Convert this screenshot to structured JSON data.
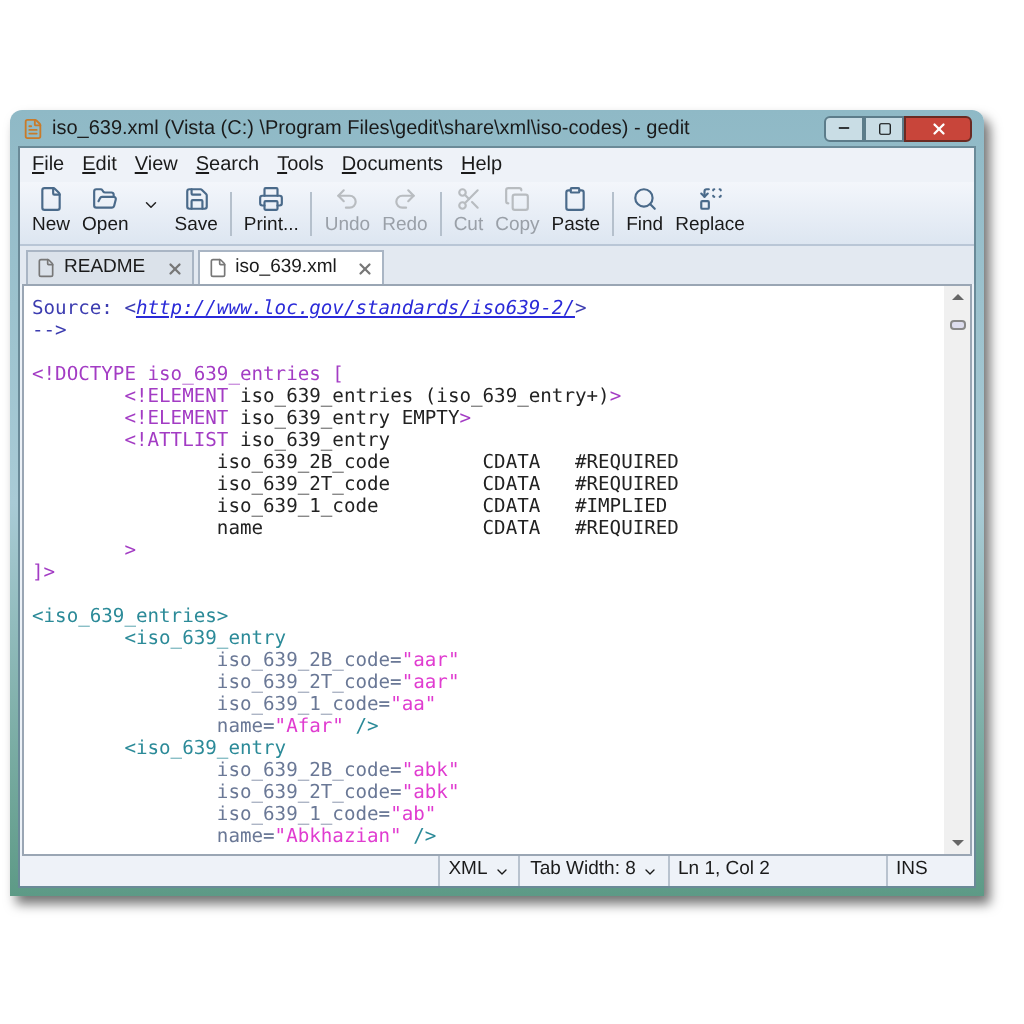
{
  "window": {
    "title": "iso_639.xml (Vista (C:) \\Program Files\\gedit\\share\\xml\\iso-codes) - gedit"
  },
  "menu": [
    "File",
    "Edit",
    "View",
    "Search",
    "Tools",
    "Documents",
    "Help"
  ],
  "toolbar": [
    {
      "label": "New",
      "disabled": false
    },
    {
      "label": "Open",
      "disabled": false
    },
    {
      "label": "Save",
      "disabled": false
    },
    {
      "label": "Print...",
      "disabled": false
    },
    {
      "label": "Undo",
      "disabled": true
    },
    {
      "label": "Redo",
      "disabled": true
    },
    {
      "label": "Cut",
      "disabled": true
    },
    {
      "label": "Copy",
      "disabled": true
    },
    {
      "label": "Paste",
      "disabled": false
    },
    {
      "label": "Find",
      "disabled": false
    },
    {
      "label": "Replace",
      "disabled": false
    }
  ],
  "tabs": [
    {
      "label": "README",
      "selected": false
    },
    {
      "label": "iso_639.xml",
      "selected": true
    }
  ],
  "code_lines": [
    {
      "segments": [
        {
          "kind": "comment",
          "text": "Source: <"
        },
        {
          "kind": "link",
          "text": "http://www.loc.gov/standards/iso639-2/"
        },
        {
          "kind": "comment",
          "text": ">"
        }
      ]
    },
    {
      "segments": [
        {
          "kind": "comment",
          "text": "-->"
        }
      ]
    },
    {
      "kind": "blank"
    },
    {
      "segments": [
        {
          "kind": "doctype",
          "text": "<!DOCTYPE iso_639_entries ["
        }
      ]
    },
    {
      "segments": [
        {
          "kind": "doctype",
          "text": "        <!ELEMENT"
        },
        {
          "kind": "plain",
          "text": " iso_639_entries (iso_639_entry+)"
        },
        {
          "kind": "doctype",
          "text": ">"
        }
      ]
    },
    {
      "segments": [
        {
          "kind": "doctype",
          "text": "        <!ELEMENT"
        },
        {
          "kind": "plain",
          "text": " iso_639_entry EMPTY"
        },
        {
          "kind": "doctype",
          "text": ">"
        }
      ]
    },
    {
      "segments": [
        {
          "kind": "doctype",
          "text": "        <!ATTLIST"
        },
        {
          "kind": "plain",
          "text": " iso_639_entry"
        }
      ]
    },
    {
      "segments": [
        {
          "kind": "plain",
          "text": "                iso_639_2B_code        CDATA   #REQUIRED"
        }
      ]
    },
    {
      "segments": [
        {
          "kind": "plain",
          "text": "                iso_639_2T_code        CDATA   #REQUIRED"
        }
      ]
    },
    {
      "segments": [
        {
          "kind": "plain",
          "text": "                iso_639_1_code         CDATA   #IMPLIED"
        }
      ]
    },
    {
      "segments": [
        {
          "kind": "plain",
          "text": "                name                   CDATA   #REQUIRED"
        }
      ]
    },
    {
      "segments": [
        {
          "kind": "doctype",
          "text": "        >"
        }
      ]
    },
    {
      "segments": [
        {
          "kind": "doctype",
          "text": "]>"
        }
      ]
    },
    {
      "kind": "blank"
    },
    {
      "segments": [
        {
          "kind": "tag",
          "text": "<iso_639_entries>"
        }
      ]
    },
    {
      "segments": [
        {
          "kind": "tag",
          "text": "        <iso_639_entry"
        }
      ]
    },
    {
      "segments": [
        {
          "kind": "attr",
          "text": "                iso_639_2B_code="
        },
        {
          "kind": "value",
          "text": "\"aar\""
        }
      ]
    },
    {
      "segments": [
        {
          "kind": "attr",
          "text": "                iso_639_2T_code="
        },
        {
          "kind": "value",
          "text": "\"aar\""
        }
      ]
    },
    {
      "segments": [
        {
          "kind": "attr",
          "text": "                iso_639_1_code="
        },
        {
          "kind": "value",
          "text": "\"aa\""
        }
      ]
    },
    {
      "segments": [
        {
          "kind": "attr",
          "text": "                name="
        },
        {
          "kind": "value",
          "text": "\"Afar\""
        },
        {
          "kind": "tag",
          "text": " />"
        }
      ]
    },
    {
      "segments": [
        {
          "kind": "tag",
          "text": "        <iso_639_entry"
        }
      ]
    },
    {
      "segments": [
        {
          "kind": "attr",
          "text": "                iso_639_2B_code="
        },
        {
          "kind": "value",
          "text": "\"abk\""
        }
      ]
    },
    {
      "segments": [
        {
          "kind": "attr",
          "text": "                iso_639_2T_code="
        },
        {
          "kind": "value",
          "text": "\"abk\""
        }
      ]
    },
    {
      "segments": [
        {
          "kind": "attr",
          "text": "                iso_639_1_code="
        },
        {
          "kind": "value",
          "text": "\"ab\""
        }
      ]
    },
    {
      "segments": [
        {
          "kind": "attr",
          "text": "                name="
        },
        {
          "kind": "value",
          "text": "\"Abkhazian\""
        },
        {
          "kind": "tag",
          "text": " />"
        }
      ]
    }
  ],
  "status_bar": {
    "language": "XML",
    "tab_width": "Tab Width: 8",
    "position": "Ln 1, Col 2",
    "mode": "INS"
  }
}
